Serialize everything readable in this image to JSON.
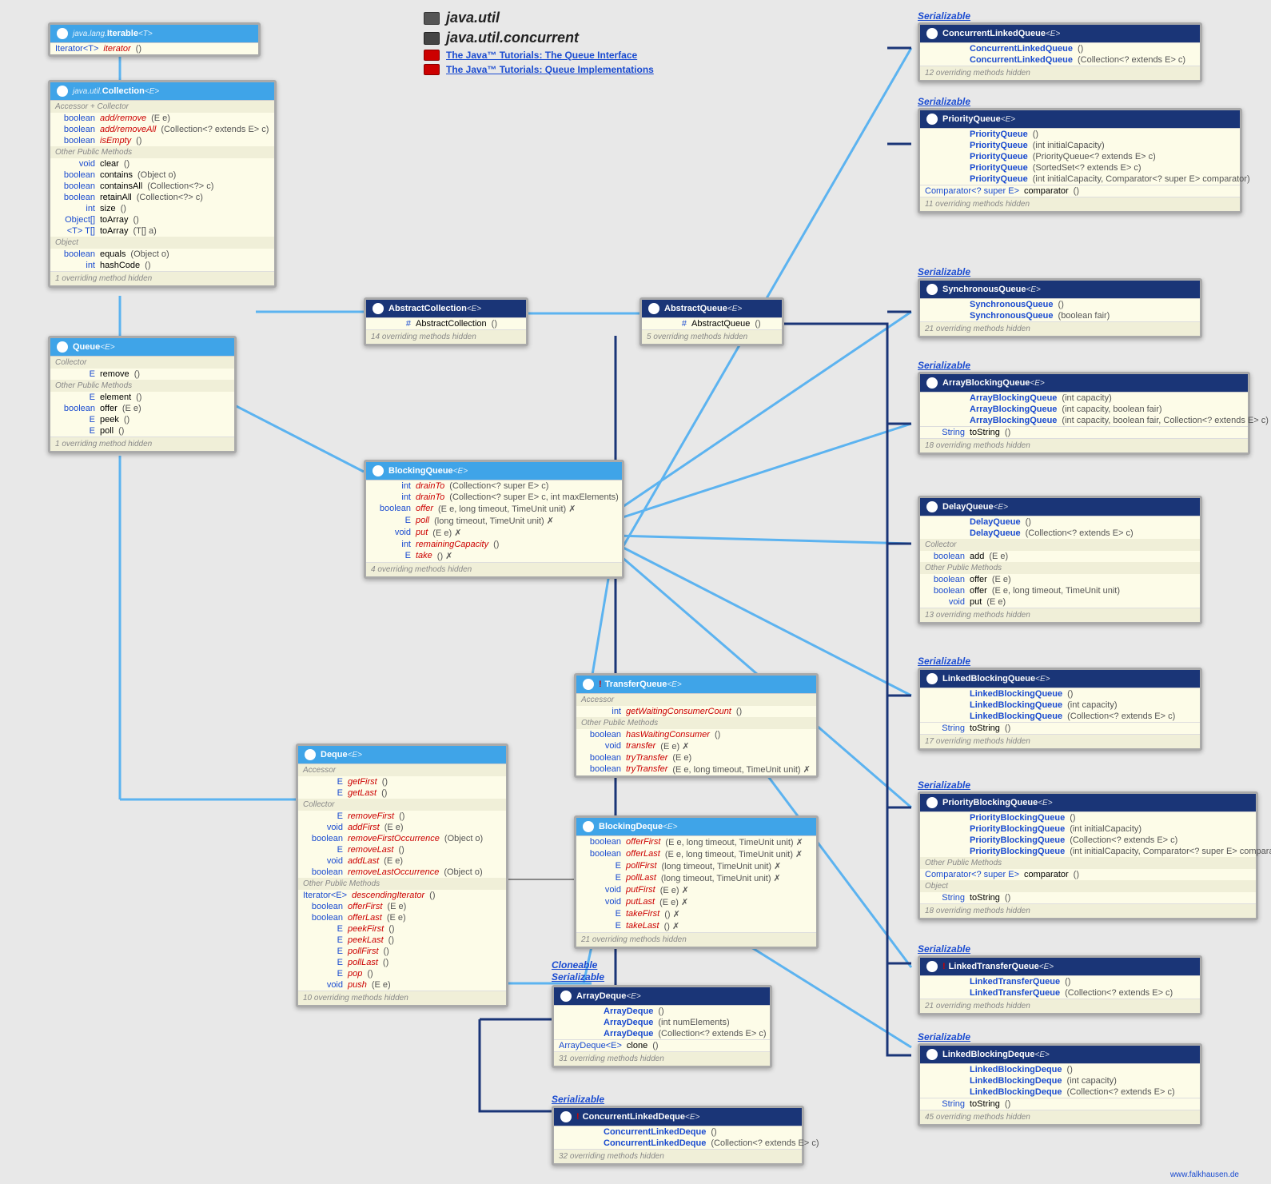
{
  "legend": {
    "pkg1": "java.util",
    "pkg2": "java.util.concurrent",
    "link1": "The Java™ Tutorials: The Queue Interface",
    "link2": "The Java™ Tutorials: Queue Implementations"
  },
  "credit": "www.falkhausen.de",
  "tags": {
    "serializable": "Serializable",
    "cloneable": "Cloneable"
  },
  "iterable": {
    "title_pkg": "java.lang.",
    "title_name": "Iterable",
    "title_param": "<T>",
    "rows": [
      {
        "ret": "Iterator<T>",
        "name": "iterator",
        "params": "()"
      }
    ]
  },
  "collection": {
    "title_pkg": "java.util.",
    "title_name": "Collection",
    "title_param": "<E>",
    "grp1": "Accessor + Collector",
    "rows1": [
      {
        "ret": "boolean",
        "name": "add/remove",
        "params": "(E e)",
        "abs": true
      },
      {
        "ret": "boolean",
        "name": "add/removeAll",
        "params": "(Collection<? extends E> c)",
        "abs": true
      },
      {
        "ret": "boolean",
        "name": "isEmpty",
        "params": "()",
        "abs": true
      }
    ],
    "grp2": "Other Public Methods",
    "rows2": [
      {
        "ret": "void",
        "name": "clear",
        "params": "()"
      },
      {
        "ret": "boolean",
        "name": "contains",
        "params": "(Object o)"
      },
      {
        "ret": "boolean",
        "name": "containsAll",
        "params": "(Collection<?> c)"
      },
      {
        "ret": "boolean",
        "name": "retainAll",
        "params": "(Collection<?> c)"
      },
      {
        "ret": "int",
        "name": "size",
        "params": "()"
      },
      {
        "ret": "Object[]",
        "name": "toArray",
        "params": "()"
      },
      {
        "ret": "<T> T[]",
        "name": "toArray",
        "params": "(T[] a)"
      }
    ],
    "grp3": "Object",
    "rows3": [
      {
        "ret": "boolean",
        "name": "equals",
        "params": "(Object o)"
      },
      {
        "ret": "int",
        "name": "hashCode",
        "params": "()"
      }
    ],
    "footer": "1 overriding method hidden"
  },
  "queue": {
    "title_name": "Queue",
    "title_param": "<E>",
    "grp1": "Collector",
    "rows1": [
      {
        "ret": "E",
        "name": "remove",
        "params": "()"
      }
    ],
    "grp2": "Other Public Methods",
    "rows2": [
      {
        "ret": "E",
        "name": "element",
        "params": "()"
      },
      {
        "ret": "boolean",
        "name": "offer",
        "params": "(E e)"
      },
      {
        "ret": "E",
        "name": "peek",
        "params": "()"
      },
      {
        "ret": "E",
        "name": "poll",
        "params": "()"
      }
    ],
    "footer": "1 overriding method hidden"
  },
  "abscoll": {
    "title_name": "AbstractCollection",
    "title_param": "<E>",
    "rows": [
      {
        "ret": "#",
        "name": "AbstractCollection",
        "params": "()"
      }
    ],
    "footer": "14 overriding methods hidden"
  },
  "absqueue": {
    "title_name": "AbstractQueue",
    "title_param": "<E>",
    "rows": [
      {
        "ret": "#",
        "name": "AbstractQueue",
        "params": "()"
      }
    ],
    "footer": "5 overriding methods hidden"
  },
  "blockingqueue": {
    "title_name": "BlockingQueue",
    "title_param": "<E>",
    "rows": [
      {
        "ret": "int",
        "name": "drainTo",
        "params": "(Collection<? super E> c)",
        "abs": true
      },
      {
        "ret": "int",
        "name": "drainTo",
        "params": "(Collection<? super E> c, int maxElements)",
        "abs": true
      },
      {
        "ret": "boolean",
        "name": "offer",
        "params": "(E e, long timeout, TimeUnit unit) ✗",
        "abs": true
      },
      {
        "ret": "E",
        "name": "poll",
        "params": "(long timeout, TimeUnit unit) ✗",
        "abs": true
      },
      {
        "ret": "void",
        "name": "put",
        "params": "(E e) ✗",
        "abs": true
      },
      {
        "ret": "int",
        "name": "remainingCapacity",
        "params": "()",
        "abs": true
      },
      {
        "ret": "E",
        "name": "take",
        "params": "() ✗",
        "abs": true
      }
    ],
    "footer": "4 overriding methods hidden"
  },
  "transferqueue": {
    "title_name": "TransferQueue",
    "title_param": "<E>",
    "grp1": "Accessor",
    "rows1": [
      {
        "ret": "int",
        "name": "getWaitingConsumerCount",
        "params": "()",
        "abs": true
      }
    ],
    "grp2": "Other Public Methods",
    "rows2": [
      {
        "ret": "boolean",
        "name": "hasWaitingConsumer",
        "params": "()",
        "abs": true
      },
      {
        "ret": "void",
        "name": "transfer",
        "params": "(E e) ✗",
        "abs": true
      },
      {
        "ret": "boolean",
        "name": "tryTransfer",
        "params": "(E e)",
        "abs": true
      },
      {
        "ret": "boolean",
        "name": "tryTransfer",
        "params": "(E e, long timeout, TimeUnit unit) ✗",
        "abs": true
      }
    ]
  },
  "deque": {
    "title_name": "Deque",
    "title_param": "<E>",
    "grp1": "Accessor",
    "rows1": [
      {
        "ret": "E",
        "name": "getFirst",
        "params": "()",
        "abs": true
      },
      {
        "ret": "E",
        "name": "getLast",
        "params": "()",
        "abs": true
      }
    ],
    "grp2": "Collector",
    "rows2": [
      {
        "ret": "E",
        "name": "removeFirst",
        "params": "()",
        "abs": true
      },
      {
        "ret": "void",
        "name": "addFirst",
        "params": "(E e)",
        "abs": true
      },
      {
        "ret": "boolean",
        "name": "removeFirstOccurrence",
        "params": "(Object o)",
        "abs": true
      },
      {
        "ret": "E",
        "name": "removeLast",
        "params": "()",
        "abs": true
      },
      {
        "ret": "void",
        "name": "addLast",
        "params": "(E e)",
        "abs": true
      },
      {
        "ret": "boolean",
        "name": "removeLastOccurrence",
        "params": "(Object o)",
        "abs": true
      }
    ],
    "grp3": "Other Public Methods",
    "rows3": [
      {
        "ret": "Iterator<E>",
        "name": "descendingIterator",
        "params": "()",
        "abs": true
      },
      {
        "ret": "boolean",
        "name": "offerFirst",
        "params": "(E e)",
        "abs": true
      },
      {
        "ret": "boolean",
        "name": "offerLast",
        "params": "(E e)",
        "abs": true
      },
      {
        "ret": "E",
        "name": "peekFirst",
        "params": "()",
        "abs": true
      },
      {
        "ret": "E",
        "name": "peekLast",
        "params": "()",
        "abs": true
      },
      {
        "ret": "E",
        "name": "pollFirst",
        "params": "()",
        "abs": true
      },
      {
        "ret": "E",
        "name": "pollLast",
        "params": "()",
        "abs": true
      },
      {
        "ret": "E",
        "name": "pop",
        "params": "()",
        "abs": true
      },
      {
        "ret": "void",
        "name": "push",
        "params": "(E e)",
        "abs": true
      }
    ],
    "footer": "10 overriding methods hidden"
  },
  "blockingdeque": {
    "title_name": "BlockingDeque",
    "title_param": "<E>",
    "rows": [
      {
        "ret": "boolean",
        "name": "offerFirst",
        "params": "(E e, long timeout, TimeUnit unit) ✗",
        "abs": true
      },
      {
        "ret": "boolean",
        "name": "offerLast",
        "params": "(E e, long timeout, TimeUnit unit) ✗",
        "abs": true
      },
      {
        "ret": "E",
        "name": "pollFirst",
        "params": "(long timeout, TimeUnit unit) ✗",
        "abs": true
      },
      {
        "ret": "E",
        "name": "pollLast",
        "params": "(long timeout, TimeUnit unit) ✗",
        "abs": true
      },
      {
        "ret": "void",
        "name": "putFirst",
        "params": "(E e) ✗",
        "abs": true
      },
      {
        "ret": "void",
        "name": "putLast",
        "params": "(E e) ✗",
        "abs": true
      },
      {
        "ret": "E",
        "name": "takeFirst",
        "params": "() ✗",
        "abs": true
      },
      {
        "ret": "E",
        "name": "takeLast",
        "params": "() ✗",
        "abs": true
      }
    ],
    "footer": "21 overriding methods hidden"
  },
  "arraydeque": {
    "title_name": "ArrayDeque",
    "title_param": "<E>",
    "rows": [
      {
        "ret": "",
        "name": "ArrayDeque",
        "params": "()",
        "ctor": true
      },
      {
        "ret": "",
        "name": "ArrayDeque",
        "params": "(int numElements)",
        "ctor": true
      },
      {
        "ret": "",
        "name": "ArrayDeque",
        "params": "(Collection<? extends E> c)",
        "ctor": true
      }
    ],
    "rows2": [
      {
        "ret": "ArrayDeque<E>",
        "name": "clone",
        "params": "()"
      }
    ],
    "footer": "31 overriding methods hidden"
  },
  "concurrentlinkeddeque": {
    "title_name": "ConcurrentLinkedDeque",
    "title_param": "<E>",
    "rows": [
      {
        "ret": "",
        "name": "ConcurrentLinkedDeque",
        "params": "()",
        "ctor": true
      },
      {
        "ret": "",
        "name": "ConcurrentLinkedDeque",
        "params": "(Collection<? extends E> c)",
        "ctor": true
      }
    ],
    "footer": "32 overriding methods hidden"
  },
  "concurrentlinkedqueue": {
    "title_name": "ConcurrentLinkedQueue",
    "title_param": "<E>",
    "rows": [
      {
        "ret": "",
        "name": "ConcurrentLinkedQueue",
        "params": "()",
        "ctor": true
      },
      {
        "ret": "",
        "name": "ConcurrentLinkedQueue",
        "params": "(Collection<? extends E> c)",
        "ctor": true
      }
    ],
    "footer": "12 overriding methods hidden"
  },
  "priorityqueue": {
    "title_name": "PriorityQueue",
    "title_param": "<E>",
    "rows": [
      {
        "ret": "",
        "name": "PriorityQueue",
        "params": "()",
        "ctor": true
      },
      {
        "ret": "",
        "name": "PriorityQueue",
        "params": "(int initialCapacity)",
        "ctor": true
      },
      {
        "ret": "",
        "name": "PriorityQueue",
        "params": "(PriorityQueue<? extends E> c)",
        "ctor": true
      },
      {
        "ret": "",
        "name": "PriorityQueue",
        "params": "(SortedSet<? extends E> c)",
        "ctor": true
      },
      {
        "ret": "",
        "name": "PriorityQueue",
        "params": "(int initialCapacity, Comparator<? super E> comparator)",
        "ctor": true
      }
    ],
    "rows2": [
      {
        "ret": "Comparator<? super E>",
        "name": "comparator",
        "params": "()"
      }
    ],
    "footer": "11 overriding methods hidden"
  },
  "synchronousqueue": {
    "title_name": "SynchronousQueue",
    "title_param": "<E>",
    "rows": [
      {
        "ret": "",
        "name": "SynchronousQueue",
        "params": "()",
        "ctor": true
      },
      {
        "ret": "",
        "name": "SynchronousQueue",
        "params": "(boolean fair)",
        "ctor": true
      }
    ],
    "footer": "21 overriding methods hidden"
  },
  "arrayblockingqueue": {
    "title_name": "ArrayBlockingQueue",
    "title_param": "<E>",
    "rows": [
      {
        "ret": "",
        "name": "ArrayBlockingQueue",
        "params": "(int capacity)",
        "ctor": true
      },
      {
        "ret": "",
        "name": "ArrayBlockingQueue",
        "params": "(int capacity, boolean fair)",
        "ctor": true
      },
      {
        "ret": "",
        "name": "ArrayBlockingQueue",
        "params": "(int capacity, boolean fair, Collection<? extends E> c)",
        "ctor": true
      }
    ],
    "rows2": [
      {
        "ret": "String",
        "name": "toString",
        "params": "()"
      }
    ],
    "footer": "18 overriding methods hidden"
  },
  "delayqueue": {
    "title_name": "DelayQueue",
    "title_param": "<E>",
    "rows": [
      {
        "ret": "",
        "name": "DelayQueue",
        "params": "()",
        "ctor": true
      },
      {
        "ret": "",
        "name": "DelayQueue",
        "params": "(Collection<? extends E> c)",
        "ctor": true
      }
    ],
    "grp2": "Collector",
    "rows2": [
      {
        "ret": "boolean",
        "name": "add",
        "params": "(E e)"
      }
    ],
    "grp3": "Other Public Methods",
    "rows3": [
      {
        "ret": "boolean",
        "name": "offer",
        "params": "(E e)"
      },
      {
        "ret": "boolean",
        "name": "offer",
        "params": "(E e, long timeout, TimeUnit unit)"
      },
      {
        "ret": "void",
        "name": "put",
        "params": "(E e)"
      }
    ],
    "footer": "13 overriding methods hidden"
  },
  "linkedblockingqueue": {
    "title_name": "LinkedBlockingQueue",
    "title_param": "<E>",
    "rows": [
      {
        "ret": "",
        "name": "LinkedBlockingQueue",
        "params": "()",
        "ctor": true
      },
      {
        "ret": "",
        "name": "LinkedBlockingQueue",
        "params": "(int capacity)",
        "ctor": true
      },
      {
        "ret": "",
        "name": "LinkedBlockingQueue",
        "params": "(Collection<? extends E> c)",
        "ctor": true
      }
    ],
    "rows2": [
      {
        "ret": "String",
        "name": "toString",
        "params": "()"
      }
    ],
    "footer": "17 overriding methods hidden"
  },
  "priorityblockingqueue": {
    "title_name": "PriorityBlockingQueue",
    "title_param": "<E>",
    "rows": [
      {
        "ret": "",
        "name": "PriorityBlockingQueue",
        "params": "()",
        "ctor": true
      },
      {
        "ret": "",
        "name": "PriorityBlockingQueue",
        "params": "(int initialCapacity)",
        "ctor": true
      },
      {
        "ret": "",
        "name": "PriorityBlockingQueue",
        "params": "(Collection<? extends E> c)",
        "ctor": true
      },
      {
        "ret": "",
        "name": "PriorityBlockingQueue",
        "params": "(int initialCapacity, Comparator<? super E> comparator)",
        "ctor": true
      }
    ],
    "grp2": "Other Public Methods",
    "rows2": [
      {
        "ret": "Comparator<? super E>",
        "name": "comparator",
        "params": "()"
      }
    ],
    "grp3": "Object",
    "rows3": [
      {
        "ret": "String",
        "name": "toString",
        "params": "()"
      }
    ],
    "footer": "18 overriding methods hidden"
  },
  "linkedtransferqueue": {
    "title_name": "LinkedTransferQueue",
    "title_param": "<E>",
    "rows": [
      {
        "ret": "",
        "name": "LinkedTransferQueue",
        "params": "()",
        "ctor": true
      },
      {
        "ret": "",
        "name": "LinkedTransferQueue",
        "params": "(Collection<? extends E> c)",
        "ctor": true
      }
    ],
    "footer": "21 overriding methods hidden"
  },
  "linkedblockingdeque": {
    "title_name": "LinkedBlockingDeque",
    "title_param": "<E>",
    "rows": [
      {
        "ret": "",
        "name": "LinkedBlockingDeque",
        "params": "()",
        "ctor": true
      },
      {
        "ret": "",
        "name": "LinkedBlockingDeque",
        "params": "(int capacity)",
        "ctor": true
      },
      {
        "ret": "",
        "name": "LinkedBlockingDeque",
        "params": "(Collection<? extends E> c)",
        "ctor": true
      }
    ],
    "rows2": [
      {
        "ret": "String",
        "name": "toString",
        "params": "()"
      }
    ],
    "footer": "45 overriding methods hidden"
  }
}
